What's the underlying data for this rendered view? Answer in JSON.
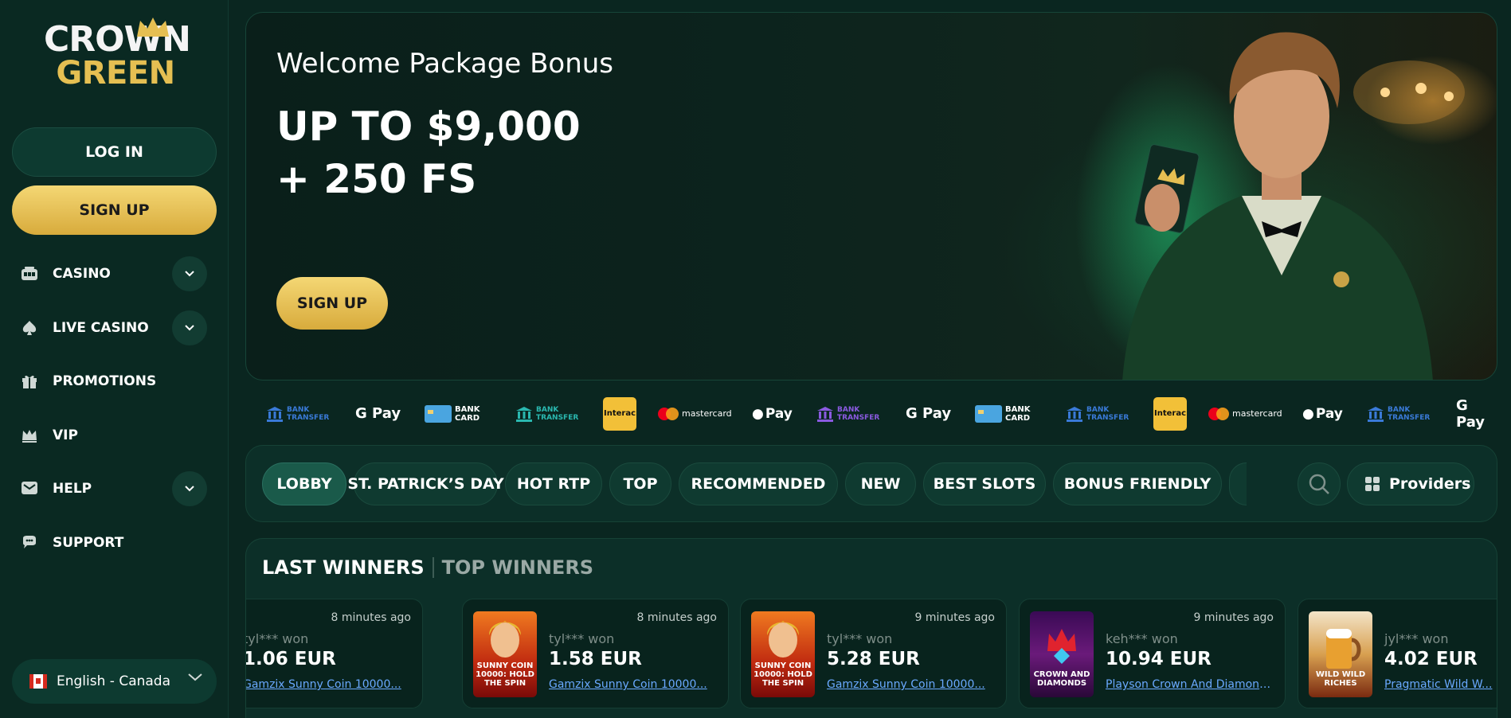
{
  "brand": {
    "line1": "CROWN",
    "line2": "GREEN"
  },
  "sidebar": {
    "login": "LOG IN",
    "signup": "SIGN UP",
    "items": [
      {
        "label": "CASINO",
        "icon": "slot-machine-icon",
        "expandable": true
      },
      {
        "label": "LIVE CASINO",
        "icon": "spade-icon",
        "expandable": true
      },
      {
        "label": "PROMOTIONS",
        "icon": "gift-icon",
        "expandable": false
      },
      {
        "label": "VIP",
        "icon": "crown-icon",
        "expandable": false
      },
      {
        "label": "HELP",
        "icon": "message-icon",
        "expandable": true
      },
      {
        "label": "SUPPORT",
        "icon": "chat-icon",
        "expandable": false
      }
    ],
    "language": "English - Canada"
  },
  "hero": {
    "title": "Welcome Package Bonus",
    "amount_line1": "UP TO $9,000",
    "amount_line2": "+ 250 FS",
    "cta": "SIGN UP"
  },
  "payments": [
    "BANK TRANSFER",
    "G Pay",
    "BANK CARD",
    "BANK TRANSFER",
    "Interac",
    "mastercard",
    "Pay",
    "BANK TRANSFER",
    "G Pay",
    "BANK CARD",
    "BANK TRANSFER",
    "Interac",
    "mastercard",
    "Pay",
    "BANK TRANSFER",
    "G Pay"
  ],
  "categories": [
    "LOBBY",
    "ST. PATRICK’S DAY",
    "HOT RTP",
    "TOP",
    "RECOMMENDED",
    "NEW",
    "BEST SLOTS",
    "BONUS FRIENDLY"
  ],
  "providers_label": "Providers",
  "winners": {
    "tab_active": "LAST WINNERS",
    "tab_inactive": "TOP WINNERS",
    "cards": [
      {
        "time": "8 minutes ago",
        "user": "tyl*** won",
        "amount": "1.06 EUR",
        "game": "Gamzix Sunny Coin 10000...",
        "thumb": ""
      },
      {
        "time": "8 minutes ago",
        "user": "tyl*** won",
        "amount": "1.58 EUR",
        "game": "Gamzix Sunny Coin 10000...",
        "thumb": "SUNNY COIN 10000: HOLD THE SPIN"
      },
      {
        "time": "9 minutes ago",
        "user": "tyl*** won",
        "amount": "5.28 EUR",
        "game": "Gamzix Sunny Coin 10000...",
        "thumb": "SUNNY COIN 10000: HOLD THE SPIN"
      },
      {
        "time": "9 minutes ago",
        "user": "keh*** won",
        "amount": "10.94 EUR",
        "game": "Playson Crown And Diamonds...",
        "thumb": "CROWN AND DIAMONDS"
      },
      {
        "time": "",
        "user": "jyl*** won",
        "amount": "4.02 EUR",
        "game": "Pragmatic Wild W...",
        "thumb": "WILD WILD RICHES"
      }
    ]
  },
  "colors": {
    "gold": "#e5bf52",
    "bg": "#0a2620",
    "link": "#6aa9ff"
  }
}
